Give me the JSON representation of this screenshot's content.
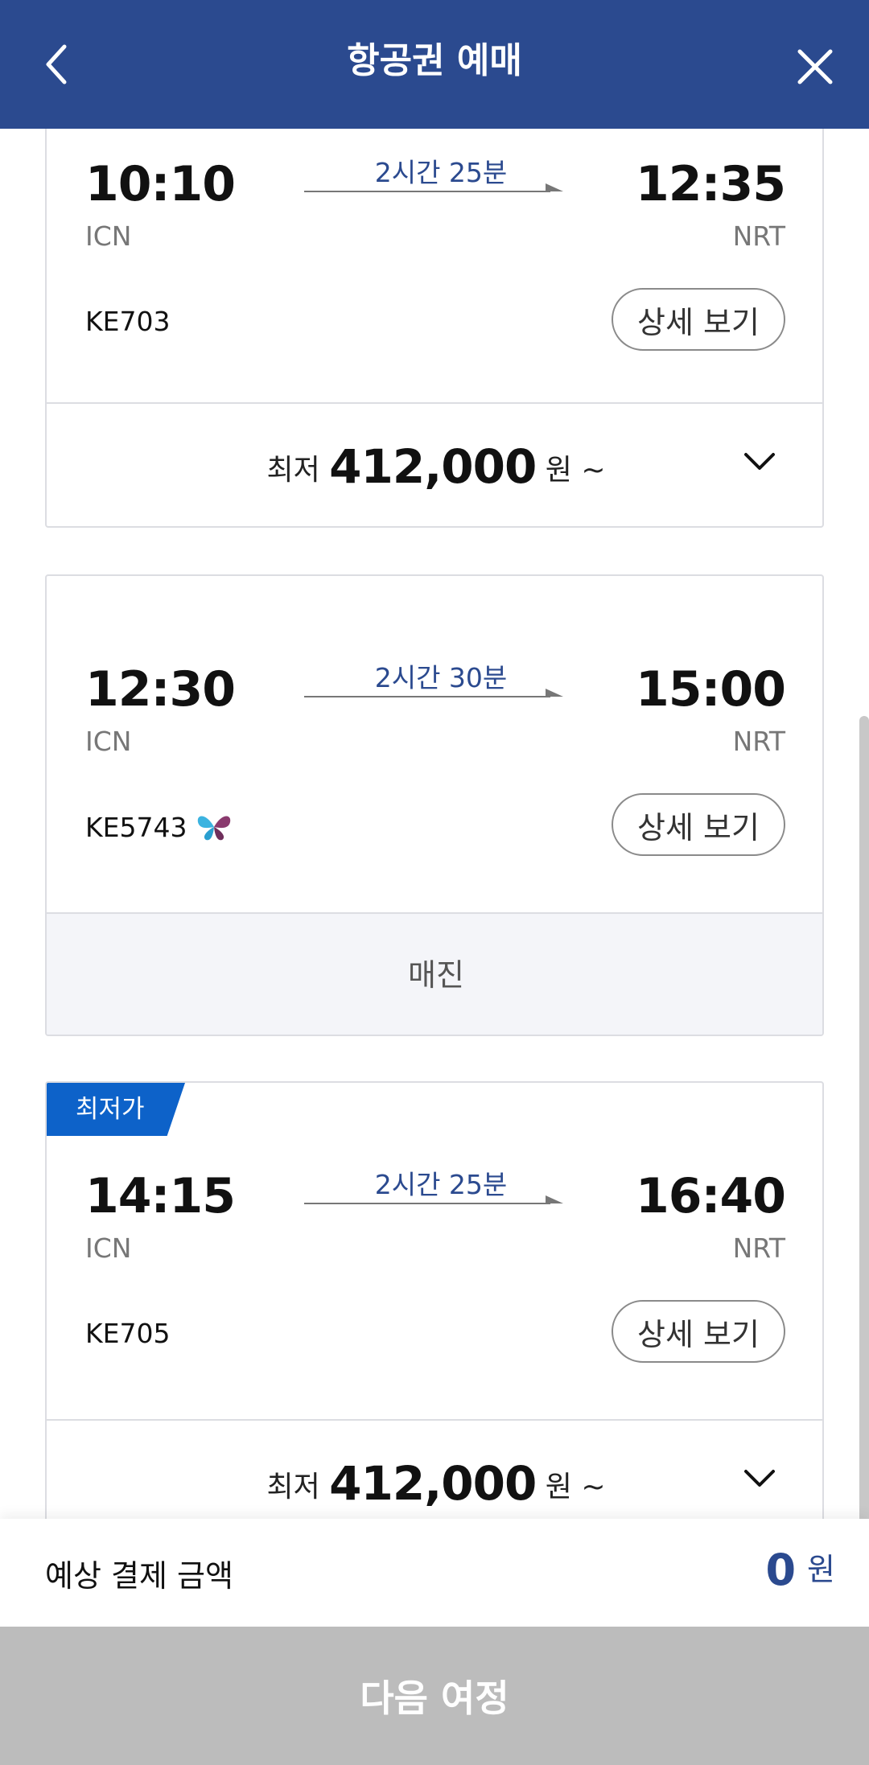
{
  "header": {
    "title": "항공권 예매",
    "back_icon": "chevron-left-icon",
    "close_icon": "close-icon",
    "background": "#2b4a8f"
  },
  "flights": [
    {
      "departure_time": "10:10",
      "departure_airport": "ICN",
      "arrival_time": "12:35",
      "arrival_airport": "NRT",
      "duration": "2시간 25분",
      "flight_number": "KE703",
      "detail_label": "상세 보기",
      "price_prefix": "최저",
      "price": "412,000",
      "price_suffix": "원 ~"
    },
    {
      "departure_time": "12:30",
      "departure_airport": "ICN",
      "arrival_time": "15:00",
      "arrival_airport": "NRT",
      "duration": "2시간 30분",
      "flight_number": "KE5743",
      "partner_icon": "butterfly-icon",
      "detail_label": "상세 보기",
      "status": "매진"
    },
    {
      "badge": "최저가",
      "departure_time": "14:15",
      "departure_airport": "ICN",
      "arrival_time": "16:40",
      "arrival_airport": "NRT",
      "duration": "2시간 25분",
      "flight_number": "KE705",
      "detail_label": "상세 보기",
      "price_prefix": "최저",
      "price": "412,000",
      "price_suffix": "원 ~"
    }
  ],
  "footer": {
    "total_label": "예상 결제 금액",
    "total_amount": "0",
    "total_unit": "원",
    "next_label": "다음 여정"
  },
  "colors": {
    "brand": "#2b4a8f",
    "badge": "#0d62c9",
    "disabled_button": "#bcbcbc"
  }
}
